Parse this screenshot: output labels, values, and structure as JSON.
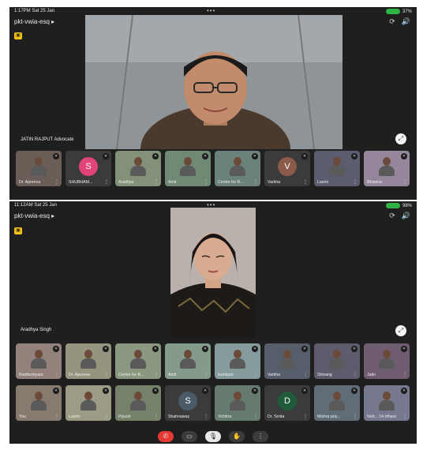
{
  "top": {
    "status_time": "1:17PM  Sat 25 Jan",
    "battery": "37%",
    "meeting_code": "pkt-vwia-esq",
    "speaker_name": "JATIN RAJPUT Advocate",
    "tiles": [
      {
        "name": "Dr. Apoorva",
        "kind": "photo"
      },
      {
        "name": "SHUBHAM...",
        "kind": "letter",
        "letter": "S",
        "color": "#e0447a"
      },
      {
        "name": "Aradhya",
        "kind": "photo"
      },
      {
        "name": "Amit",
        "kind": "photo"
      },
      {
        "name": "Centre for R...",
        "kind": "photo"
      },
      {
        "name": "Varkha",
        "kind": "letter",
        "letter": "V",
        "color": "#8b5a4a"
      },
      {
        "name": "Laxmi",
        "kind": "photo"
      },
      {
        "name": "Bhawna",
        "kind": "photo"
      }
    ]
  },
  "bottom": {
    "status_time": "11:12AM  Sat 25 Jan",
    "battery": "98%",
    "meeting_code": "pkt-vwia-esq",
    "speaker_name": "Aradhya Singh",
    "row1": [
      {
        "name": "Radheshyam",
        "kind": "photo"
      },
      {
        "name": "Dr. Apoorva",
        "kind": "photo"
      },
      {
        "name": "Centre for R...",
        "kind": "photo"
      },
      {
        "name": "Amit",
        "kind": "photo"
      },
      {
        "name": "kumkum",
        "kind": "photo"
      },
      {
        "name": "Varkha",
        "kind": "photo"
      },
      {
        "name": "Shivang",
        "kind": "photo"
      },
      {
        "name": "Jatin",
        "kind": "photo"
      }
    ],
    "row2": [
      {
        "name": "You",
        "kind": "photo"
      },
      {
        "name": "Laxmi",
        "kind": "photo"
      },
      {
        "name": "Piyush",
        "kind": "photo"
      },
      {
        "name": "Shahnawaz",
        "kind": "letter",
        "letter": "S",
        "color": "#4a5a66"
      },
      {
        "name": "Vichitra",
        "kind": "photo"
      },
      {
        "name": "Dr. Smita",
        "kind": "letter",
        "letter": "D",
        "color": "#1f5a3a"
      },
      {
        "name": "Mishra priy...",
        "kind": "photo"
      },
      {
        "name": "Neh... 14 others",
        "kind": "photo"
      }
    ],
    "controls": [
      {
        "name": "end-call-button",
        "glyph": "✆",
        "color": "#e53935"
      },
      {
        "name": "camera-button",
        "glyph": "▭",
        "color": "#3c3c3c"
      },
      {
        "name": "mic-button",
        "glyph": "🎙",
        "color": "#e8e8e8"
      },
      {
        "name": "raise-hand-button",
        "glyph": "✋",
        "color": "#3c3c3c"
      },
      {
        "name": "more-options-button",
        "glyph": "⋮",
        "color": "#3c3c3c"
      }
    ]
  },
  "icons": {
    "caption": "▣",
    "fullscreen": "⤢",
    "mute": "✕",
    "kebab": "⋮",
    "dots": "•••",
    "chevron": "▸"
  }
}
